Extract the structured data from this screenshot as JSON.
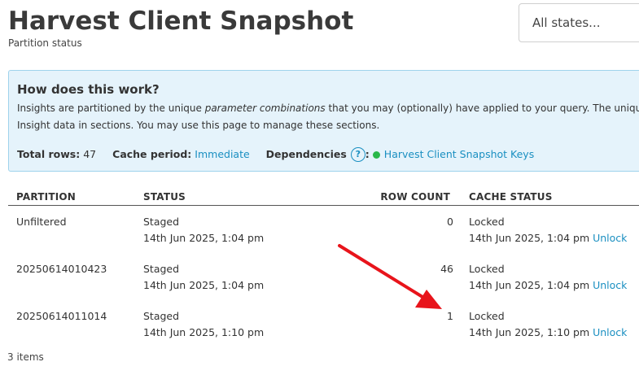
{
  "header": {
    "title": "Harvest Client Snapshot",
    "subtitle": "Partition status",
    "state_filter": "All states..."
  },
  "info": {
    "heading": "How does this work?",
    "line1_before": "Insights are partitioned by the unique ",
    "line1_em": "parameter combinations",
    "line1_after": " that you may (optionally) have applied to your query. The unique",
    "line2": "Insight data in sections. You may use this page to manage these sections.",
    "total_rows_label": "Total rows:",
    "total_rows_value": "47",
    "cache_period_label": "Cache period:",
    "cache_period_value": "Immediate",
    "dependencies_label": "Dependencies",
    "help_glyph": "?",
    "dependency_link": "Harvest Client Snapshot Keys",
    "dependency_status_color": "#2ab84a"
  },
  "table": {
    "headers": {
      "partition": "PARTITION",
      "status": "STATUS",
      "row_count": "ROW COUNT",
      "cache_status": "CACHE STATUS"
    },
    "rows": [
      {
        "partition": "Unfiltered",
        "status": "Staged",
        "status_time": "14th Jun 2025, 1:04 pm",
        "row_count": "0",
        "cache_status": "Locked",
        "cache_time": "14th Jun 2025, 1:04 pm",
        "action": "Unlock"
      },
      {
        "partition": "20250614010423",
        "status": "Staged",
        "status_time": "14th Jun 2025, 1:04 pm",
        "row_count": "46",
        "cache_status": "Locked",
        "cache_time": "14th Jun 2025, 1:04 pm",
        "action": "Unlock"
      },
      {
        "partition": "20250614011014",
        "status": "Staged",
        "status_time": "14th Jun 2025, 1:10 pm",
        "row_count": "1",
        "cache_status": "Locked",
        "cache_time": "14th Jun 2025, 1:10 pm",
        "action": "Unlock"
      }
    ]
  },
  "footer": {
    "item_count": "3 items"
  },
  "colors": {
    "link": "#1a8fc1",
    "info_bg": "#e5f3fb",
    "info_border": "#9fd3ec",
    "annotation_arrow": "#e8141b"
  }
}
